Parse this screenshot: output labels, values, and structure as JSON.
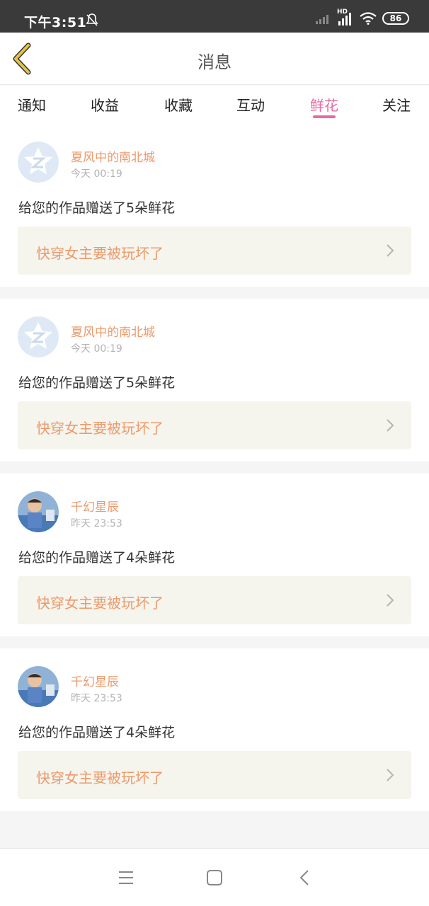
{
  "status_bar": {
    "time": "下午3:51",
    "network_label": "HD",
    "battery": "86",
    "icons": [
      "mute-bell-icon",
      "signal-off-icon",
      "signal-icon",
      "wifi-icon",
      "battery-icon"
    ]
  },
  "header": {
    "title": "消息",
    "back_icon": "chevron-left-icon",
    "accent_color": "#e5c24a"
  },
  "tabs": [
    {
      "label": "通知",
      "active": false
    },
    {
      "label": "收益",
      "active": false
    },
    {
      "label": "收藏",
      "active": false
    },
    {
      "label": "互动",
      "active": false
    },
    {
      "label": "鲜花",
      "active": true
    },
    {
      "label": "关注",
      "active": false
    }
  ],
  "colors": {
    "active_tab": "#e56aa3",
    "name": "#ec9a6c",
    "link_bg": "#f5f4ed"
  },
  "messages": [
    {
      "user": "夏风中的南北城",
      "time": "今天 00:19",
      "text": "给您的作品赠送了5朵鲜花",
      "work": "快穿女主要被玩坏了",
      "avatar": "default-avatar-icon"
    },
    {
      "user": "夏风中的南北城",
      "time": "今天 00:19",
      "text": "给您的作品赠送了5朵鲜花",
      "work": "快穿女主要被玩坏了",
      "avatar": "default-avatar-icon"
    },
    {
      "user": "千幻星辰",
      "time": "昨天 23:53",
      "text": "给您的作品赠送了4朵鲜花",
      "work": "快穿女主要被玩坏了",
      "avatar": "photo-avatar"
    },
    {
      "user": "千幻星辰",
      "time": "昨天 23:53",
      "text": "给您的作品赠送了4朵鲜花",
      "work": "快穿女主要被玩坏了",
      "avatar": "photo-avatar"
    }
  ],
  "nav_bar": {
    "icons": [
      "menu-icon",
      "home-square-icon",
      "back-triangle-icon"
    ]
  }
}
